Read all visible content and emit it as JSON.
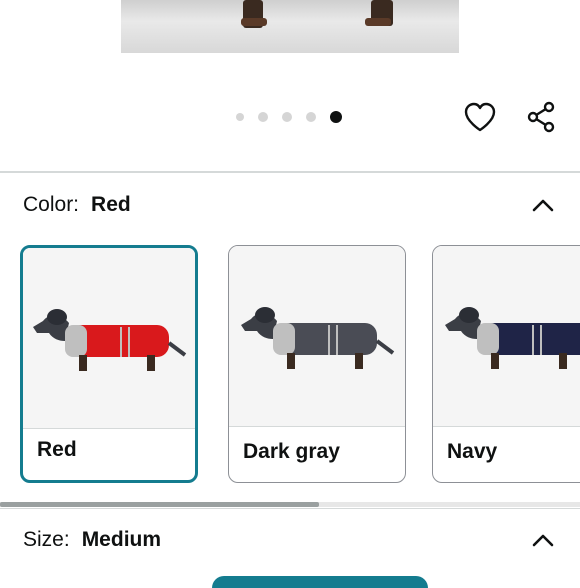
{
  "gallery": {
    "dots_total": 5,
    "active_index": 4,
    "favorite_icon": "heart-icon",
    "share_icon": "share-icon"
  },
  "color_section": {
    "label": "Color:",
    "value": "Red",
    "toggle_icon": "chevron-up-icon",
    "options": [
      {
        "name": "Red",
        "coat_color": "#d9191c",
        "selected": true
      },
      {
        "name": "Dark gray",
        "coat_color": "#4a4c55",
        "selected": false
      },
      {
        "name": "Navy",
        "coat_color": "#1f2447",
        "selected": false
      }
    ],
    "scroll_fraction": 0.55
  },
  "size_section": {
    "label": "Size:",
    "value": "Medium",
    "toggle_icon": "chevron-up-icon"
  },
  "colors": {
    "accent": "#147c8f",
    "active_dot": "#0f1111",
    "inactive_dot": "#d5d5d5"
  }
}
